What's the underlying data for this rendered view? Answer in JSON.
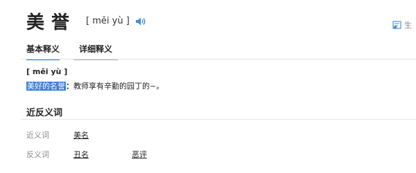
{
  "entry": {
    "word": "美誉",
    "pinyin": "[ měi yù ]"
  },
  "tool_label": "生",
  "tabs": [
    {
      "label": "基本释义"
    },
    {
      "label": "详细释义"
    }
  ],
  "basic": {
    "pinyin": "[ měi yù ]",
    "term": "美好的名誉",
    "colon": "：",
    "example": "教师享有辛勤的园丁的~。"
  },
  "synonyms_section": {
    "title": "近反义词",
    "synonym_label": "近义词",
    "synonyms": [
      "美名"
    ],
    "antonym_label": "反义词",
    "antonyms": [
      "丑名",
      "恶评"
    ]
  },
  "colors": {
    "accent": "#2a6db0",
    "highlight": "#3c7ed8"
  }
}
